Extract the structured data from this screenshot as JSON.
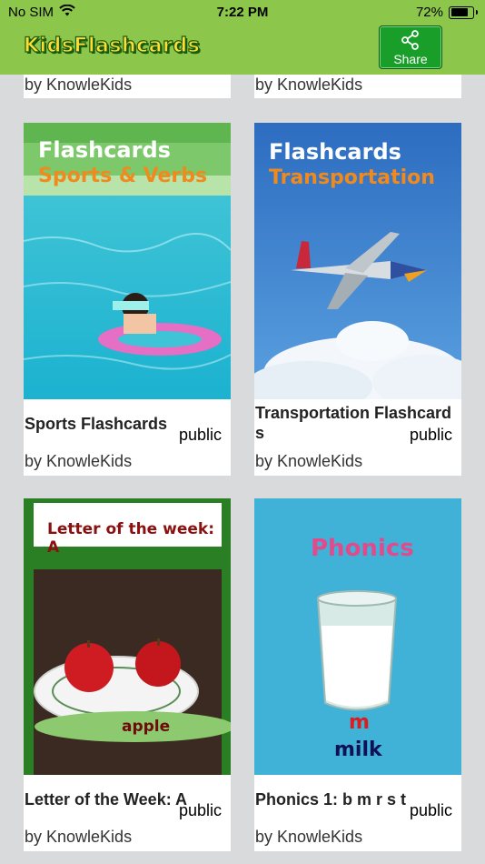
{
  "status": {
    "carrier": "No SIM",
    "time": "7:22 PM",
    "battery": "72%"
  },
  "nav": {
    "app_title": "KidsFlashcards",
    "share_label": "Share"
  },
  "top_row": [
    {
      "author": "by KnowleKids"
    },
    {
      "author": "by KnowleKids"
    }
  ],
  "cards": [
    {
      "cover_heading": "Flashcards",
      "cover_sub": "Sports & Verbs",
      "title": "Sports Flashcards",
      "visibility": "public",
      "author": "by KnowleKids"
    },
    {
      "cover_heading": "Flashcards",
      "cover_sub": "Transportation",
      "title": "Transportation Flashcards",
      "visibility": "public",
      "author": "by KnowleKids"
    },
    {
      "cover_heading": "Letter of the week: A",
      "cover_sub": "apple",
      "title": "Letter of the Week: A",
      "visibility": "public",
      "author": "by KnowleKids"
    },
    {
      "cover_heading": "Phonics",
      "cover_sub": "m",
      "cover_word": "milk",
      "title": "Phonics 1: b m r s t",
      "visibility": "public",
      "author": "by KnowleKids"
    }
  ]
}
